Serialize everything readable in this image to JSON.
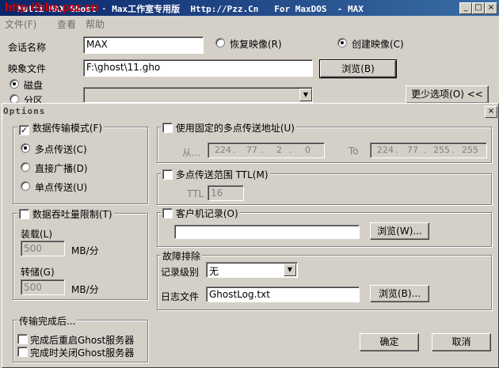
{
  "window": {
    "title": "Multi MAX Ghost · Max工作室专用版  Http://Pzz.Cn   For MaxDOS  - MAX",
    "watermark": "http://bbs.pzz.cn"
  },
  "menu": {
    "file": "文件(F)",
    "view": "查看",
    "help": "帮助"
  },
  "main": {
    "session_label": "会话名称",
    "session_value": "MAX",
    "restore_label": "恢复映像(R)",
    "create_label": "创建映像(C)",
    "image_file_label": "映象文件",
    "image_file_value": "F:\\ghost\\11.gho",
    "browse_label": "浏览(B)",
    "disk_label": "磁盘",
    "partition_label": "分区",
    "fewer_options_label": "更少选项(O) <<"
  },
  "dialog": {
    "title": "Options",
    "close": "×",
    "transfer_mode": {
      "label": "数据传输模式(F)",
      "multicast": "多点传送(C)",
      "broadcast": "直接广播(D)",
      "unicast": "单点传送(U)"
    },
    "throughput": {
      "label": "数据吞吐量限制(T)",
      "load_label": "装载(L)",
      "load_value": "500",
      "load_unit": "MB/分",
      "store_label": "转储(G)",
      "store_value": "500",
      "store_unit": "MB/分"
    },
    "after_transfer": {
      "label": "传输完成后...",
      "restart": "完成后重启Ghost服务器",
      "shutdown": "完成时关闭Ghost服务器"
    },
    "fixed_multicast": {
      "label": "使用固定的多点传送地址(U)",
      "from_label": "从...",
      "from_ip": [
        "224",
        "77",
        "2",
        "0"
      ],
      "to_label": "To",
      "to_ip": [
        "224",
        "77",
        "255",
        "255"
      ]
    },
    "ttl_range": {
      "label": "多点传送范围 TTL(M)",
      "ttl_label": "TTL",
      "ttl_value": "16"
    },
    "client_log": {
      "label": "客户机记录(O)",
      "path_value": "",
      "browse_label": "浏览(W)..."
    },
    "troubleshoot": {
      "label": "故障排除",
      "level_label": "记录级别",
      "level_value": "无",
      "logfile_label": "日志文件",
      "logfile_value": "GhostLog.txt",
      "browse_label": "浏览(B)..."
    },
    "ok_label": "确定",
    "cancel_label": "取消"
  }
}
